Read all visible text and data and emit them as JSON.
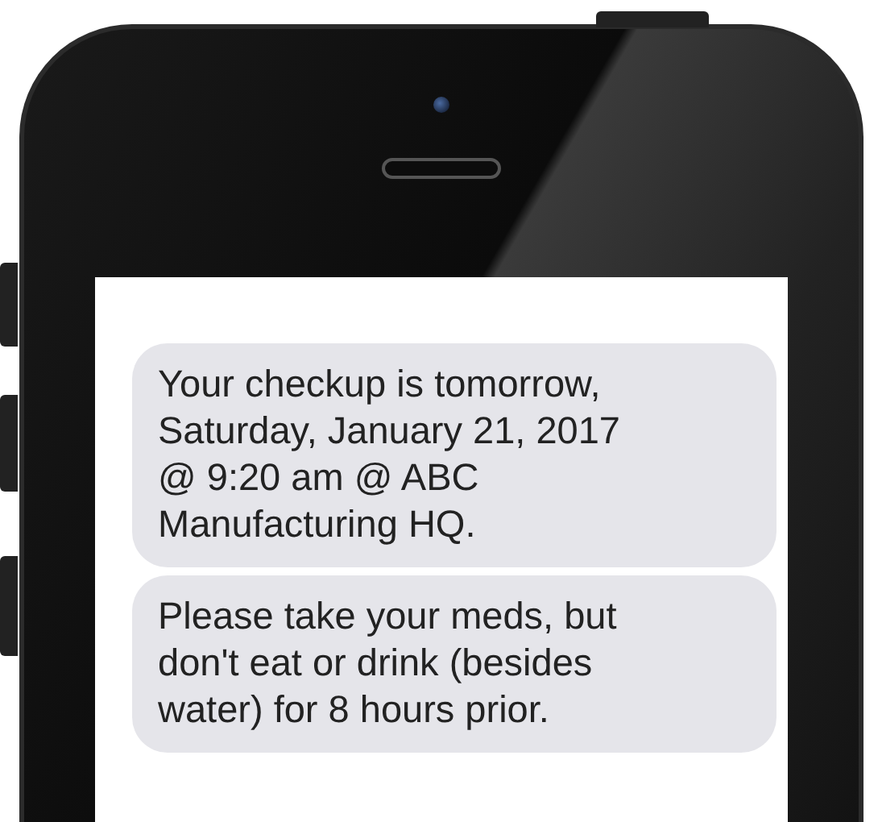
{
  "messages": [
    {
      "text": "Your checkup is tomorrow,\nSaturday, January 21, 2017\n@ 9:20 am @ ABC\nManufacturing HQ."
    },
    {
      "text": "Please take your meds, but\ndon't eat or drink (besides\nwater) for 8 hours prior."
    }
  ]
}
